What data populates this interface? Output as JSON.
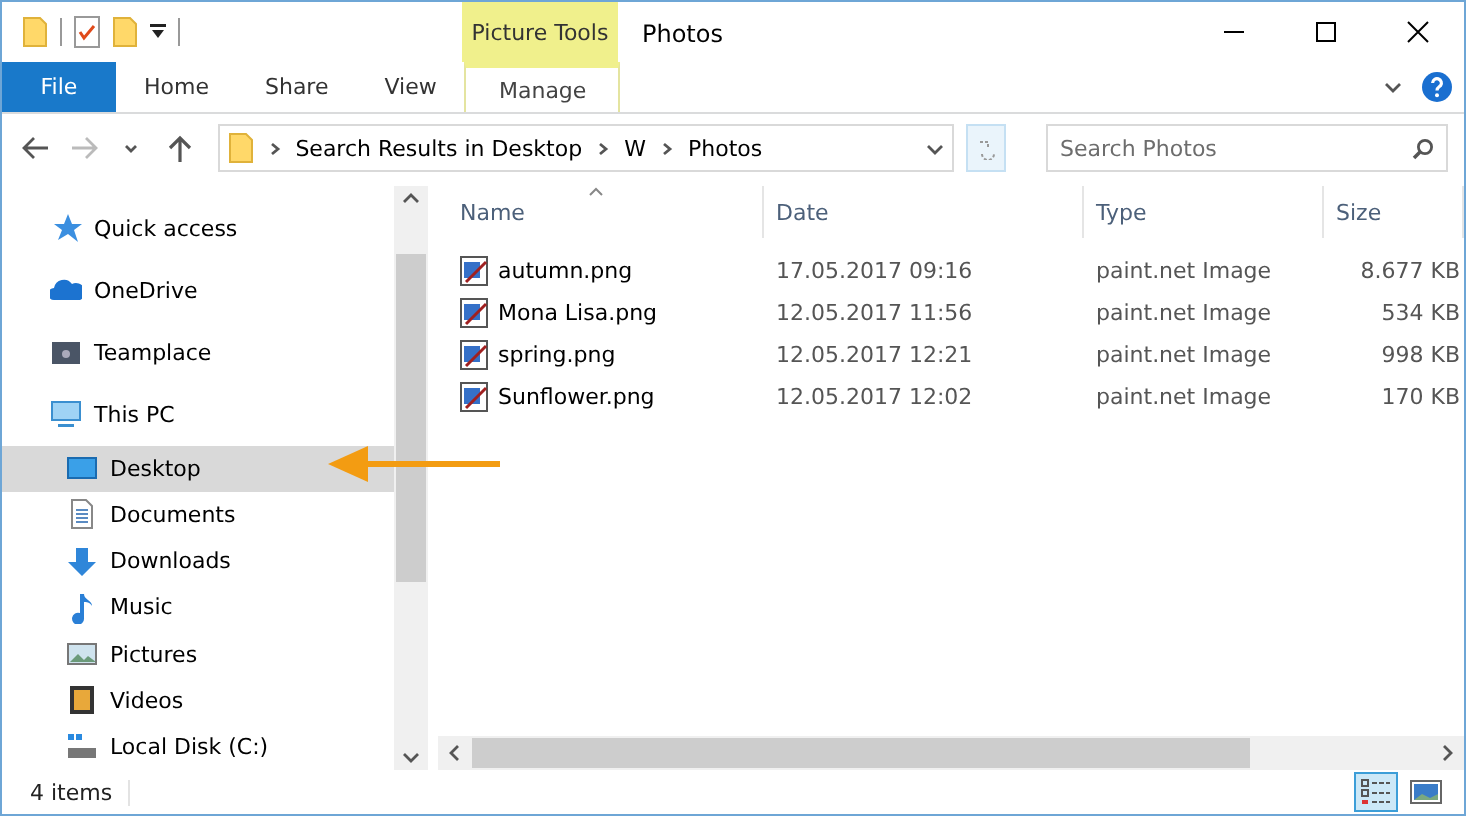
{
  "window": {
    "title": "Photos",
    "contextual_tab": "Picture Tools"
  },
  "ribbon_tabs": [
    {
      "label": "File",
      "kind": "file"
    },
    {
      "label": "Home",
      "kind": "normal"
    },
    {
      "label": "Share",
      "kind": "normal"
    },
    {
      "label": "View",
      "kind": "normal"
    },
    {
      "label": "Manage",
      "kind": "contextual"
    }
  ],
  "address": {
    "path": [
      "Search Results in Desktop",
      "W",
      "Photos"
    ]
  },
  "search": {
    "placeholder": "Search Photos"
  },
  "nav": [
    {
      "label": "Quick access",
      "kind": "star",
      "selected": false
    },
    {
      "label": "OneDrive",
      "kind": "cloud",
      "selected": false
    },
    {
      "label": "Teamplace",
      "kind": "teamplace",
      "selected": false
    },
    {
      "label": "This PC",
      "kind": "pc",
      "selected": false,
      "children": [
        {
          "label": "Desktop",
          "kind": "desktop",
          "selected": true
        },
        {
          "label": "Documents",
          "kind": "documents",
          "selected": false
        },
        {
          "label": "Downloads",
          "kind": "downloads",
          "selected": false
        },
        {
          "label": "Music",
          "kind": "music",
          "selected": false
        },
        {
          "label": "Pictures",
          "kind": "pictures",
          "selected": false
        },
        {
          "label": "Videos",
          "kind": "videos",
          "selected": false
        },
        {
          "label": "Local Disk (C:)",
          "kind": "disk",
          "selected": false
        }
      ]
    }
  ],
  "table": {
    "columns": [
      "Name",
      "Date",
      "Type",
      "Size"
    ],
    "rows": [
      [
        "autumn.png",
        "17.05.2017 09:16",
        "paint.net Image",
        "8.677 KB"
      ],
      [
        "Mona Lisa.png",
        "12.05.2017 11:56",
        "paint.net Image",
        "534 KB"
      ],
      [
        "spring.png",
        "12.05.2017 12:21",
        "paint.net Image",
        "998 KB"
      ],
      [
        "Sunflower.png",
        "12.05.2017 12:02",
        "paint.net Image",
        "170 KB"
      ]
    ]
  },
  "status_bar": {
    "text": "4 items"
  },
  "view_buttons": [
    {
      "kind": "details",
      "selected": true
    },
    {
      "kind": "large_icons",
      "selected": false
    }
  ]
}
